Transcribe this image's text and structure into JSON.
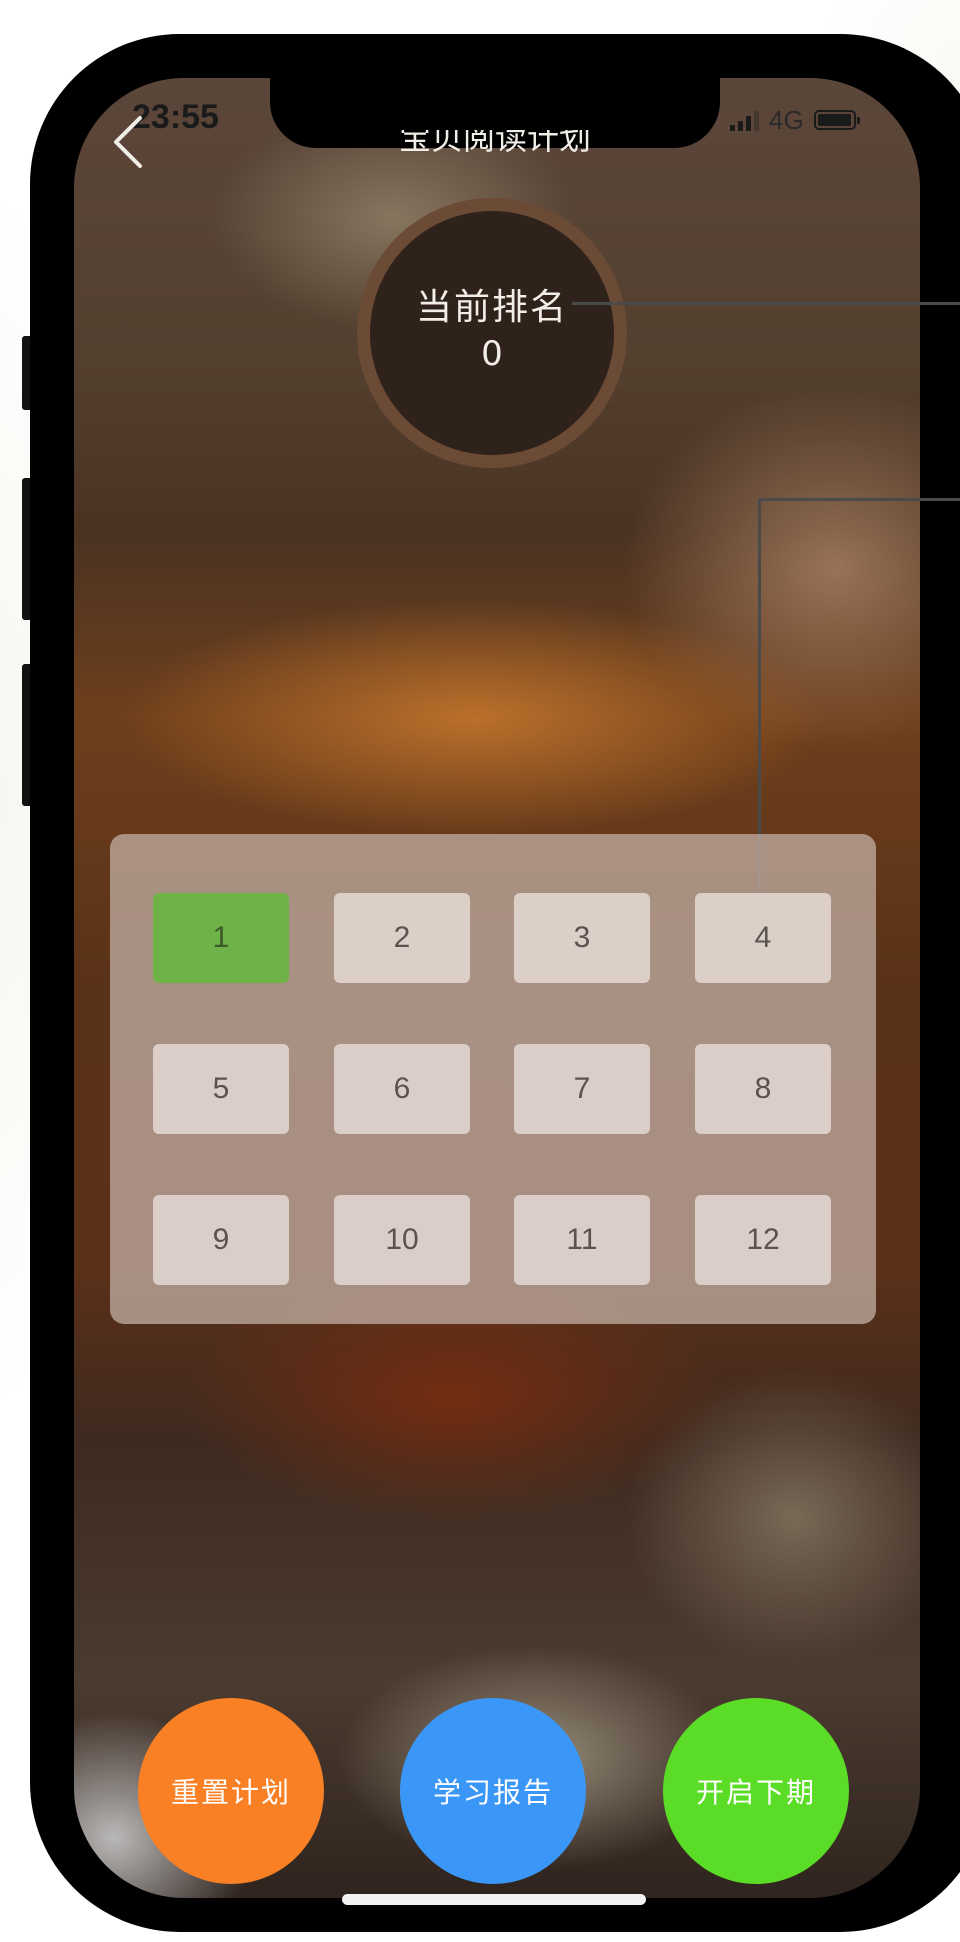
{
  "status_bar": {
    "time": "23:55",
    "network": "4G"
  },
  "header": {
    "title": "宝贝阅读计划",
    "back_icon": "chevron-left-icon"
  },
  "rank": {
    "label": "当前排名",
    "value": "0"
  },
  "plan_grid": {
    "selected": "1",
    "selected_color": "#6fb248",
    "cells": [
      "1",
      "2",
      "3",
      "4",
      "5",
      "6",
      "7",
      "8",
      "9",
      "10",
      "11",
      "12"
    ]
  },
  "actions": [
    {
      "label": "重置计划",
      "color": "#f98024"
    },
    {
      "label": "学习报告",
      "color": "#3b97f7"
    },
    {
      "label": "开启下期",
      "color": "#5bdc27"
    }
  ]
}
